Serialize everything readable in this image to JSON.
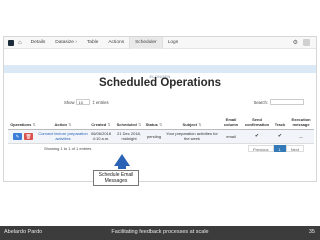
{
  "banner": "ELONGEN",
  "nav": {
    "home_icon": "⌂",
    "items": [
      "Details",
      "Datasize ›",
      "Table",
      "Actions",
      "Scheduler",
      "Logs"
    ],
    "active_index": 4
  },
  "page_title": "Scheduled Operations",
  "controls": {
    "show_label": "Show",
    "show_value": "10",
    "entries_label": "‡ entries",
    "search_label": "Search:"
  },
  "table": {
    "headers": [
      "Operations",
      "Action",
      "Created",
      "Scheduled",
      "Status",
      "Subject",
      "Email column",
      "Send confirmation",
      "Track",
      "Execution message"
    ],
    "row": {
      "action": "Connect lecture preparation activities",
      "created": "06/06/2018 4:10 a.m.",
      "scheduled": "21 Dec 2018, midnight",
      "status": "pending",
      "subject": "Your preparation activities for the week",
      "email_column": "email",
      "send_confirmation": "✔",
      "track": "✔",
      "execution_message": "—"
    }
  },
  "footer": {
    "showing": "Showing 1 to 1 of 1 entries",
    "previous": "Previous",
    "page": "1",
    "next": "Next"
  },
  "callout": {
    "line1": "Schedule Email",
    "line2": "Messages"
  },
  "bottom": {
    "author": "Abelardo Pardo",
    "talk": "Facilitating feedback processes at scale",
    "page_number": "35"
  }
}
